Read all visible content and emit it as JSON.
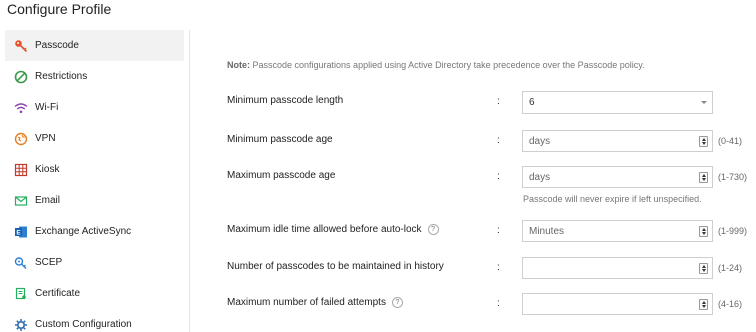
{
  "page_title": "Configure Profile",
  "sidebar": {
    "items": [
      {
        "label": "Passcode",
        "icon": "key-icon",
        "active": true
      },
      {
        "label": "Restrictions",
        "icon": "prohibited-icon"
      },
      {
        "label": "Wi-Fi",
        "icon": "wifi-icon"
      },
      {
        "label": "VPN",
        "icon": "vpn-globe-icon"
      },
      {
        "label": "Kiosk",
        "icon": "kiosk-grid-icon"
      },
      {
        "label": "Email",
        "icon": "envelope-icon"
      },
      {
        "label": "Exchange ActiveSync",
        "icon": "exchange-icon"
      },
      {
        "label": "SCEP",
        "icon": "scep-icon"
      },
      {
        "label": "Certificate",
        "icon": "certificate-icon"
      },
      {
        "label": "Custom Configuration",
        "icon": "gear-icon"
      }
    ]
  },
  "note": {
    "prefix": "Note:",
    "text": " Passcode configurations applied using Active Directory take precedence over the Passcode policy."
  },
  "form": {
    "min_length": {
      "label": "Minimum passcode length",
      "value": "6"
    },
    "min_age": {
      "label": "Minimum passcode age",
      "placeholder": "days",
      "range": "(0-41)"
    },
    "max_age": {
      "label": "Maximum passcode age",
      "placeholder": "days",
      "range": "(1-730)",
      "hint": "Passcode will never expire if left unspecified."
    },
    "idle_time": {
      "label": "Maximum idle time allowed before auto-lock",
      "placeholder": "Minutes",
      "range": "(1-999)",
      "help": "?"
    },
    "history": {
      "label": "Number of passcodes to be maintained in history",
      "placeholder": "",
      "range": "(1-24)"
    },
    "failed_attempts": {
      "label": "Maximum number of failed attempts",
      "placeholder": "",
      "range": "(4-16)",
      "help": "?"
    },
    "colon": ":"
  },
  "colors": {
    "accent": "#e8542e",
    "active_bg": "#f2f2f2"
  }
}
